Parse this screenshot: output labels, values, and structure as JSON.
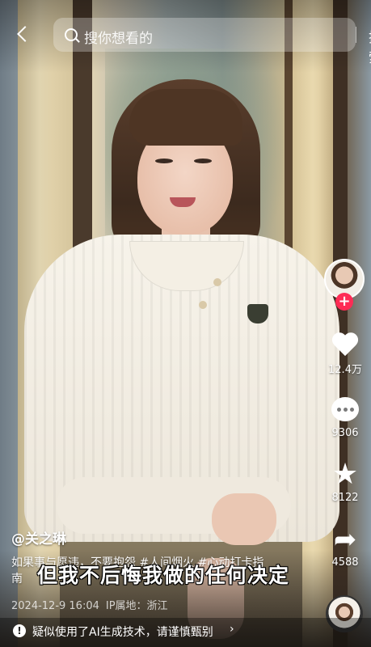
{
  "search": {
    "placeholder": "搜你想看的",
    "button_label": "搜索"
  },
  "actions": {
    "likes": "12.4万",
    "comments": "9306",
    "favorites": "8122",
    "shares": "4588"
  },
  "video": {
    "author": "@关之琳",
    "description": "如果事与愿违，不要抱怨 #人间烟火 #心动打卡指南",
    "date": "2024-12-9 16:04",
    "ip_location": "IP属地：浙江",
    "subtitle": "但我不后悔我做的任何决定"
  },
  "notice": {
    "text": "疑似使用了AI生成技术，请谨慎甄别",
    "chevron": "›"
  },
  "icons": {
    "back": "back-icon",
    "search": "search-icon",
    "like": "heart-icon",
    "comment": "comment-icon",
    "favorite": "star-icon",
    "share": "share-icon",
    "warning": "warning-icon"
  },
  "colors": {
    "follow": "#fe2c55"
  }
}
